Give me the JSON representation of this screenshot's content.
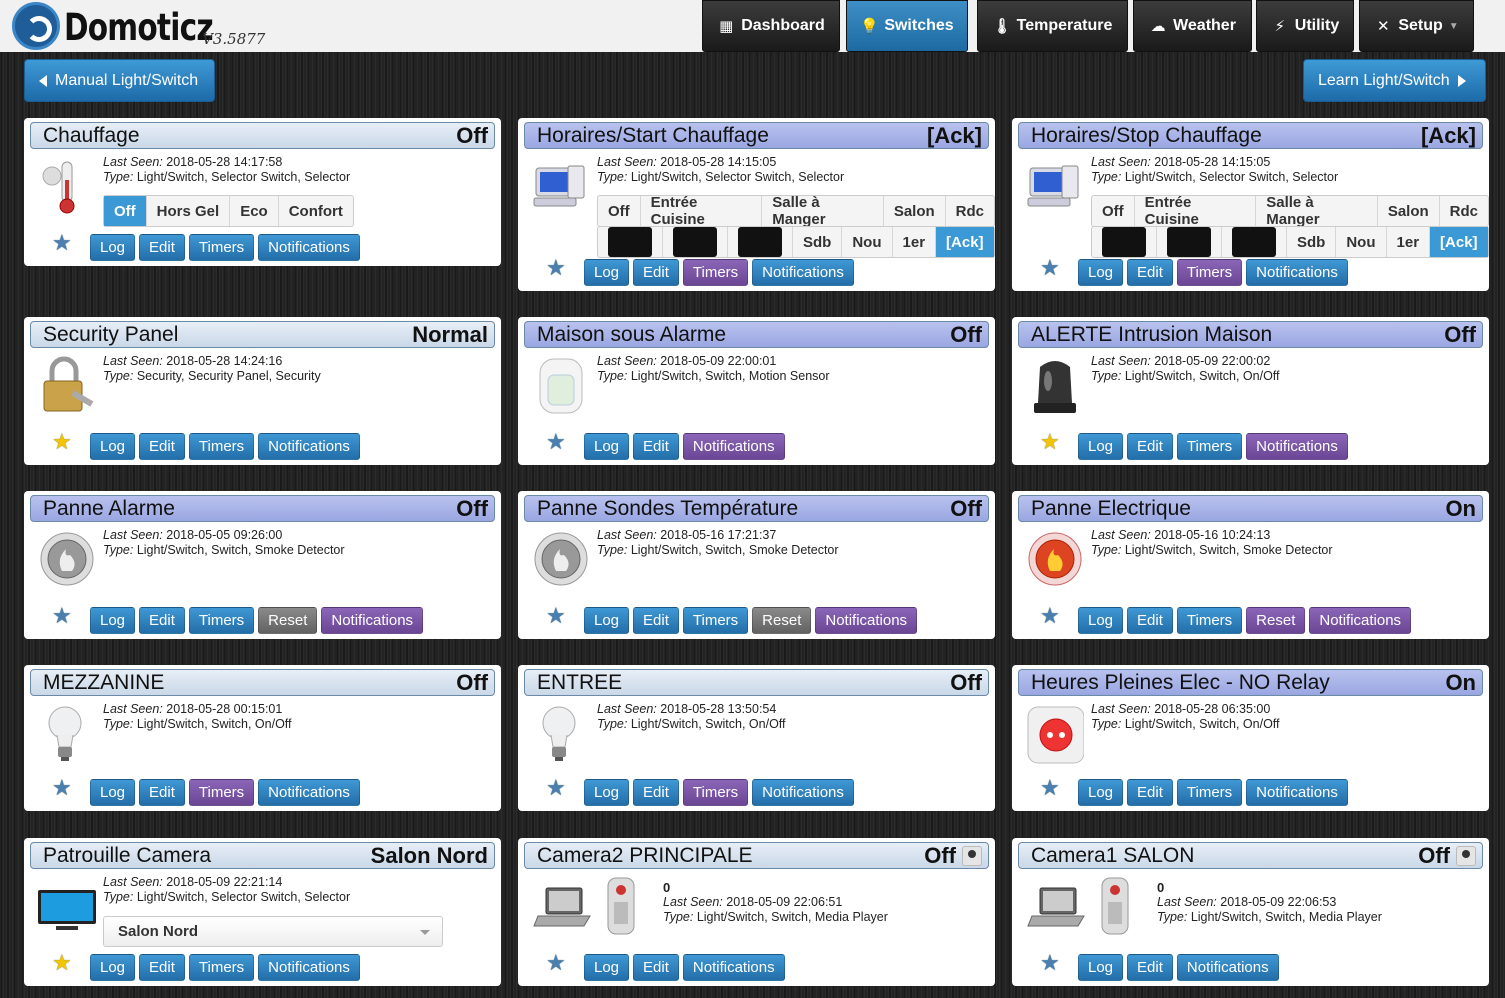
{
  "app": {
    "name": "Domoticz",
    "version": "V3.5877"
  },
  "nav": [
    {
      "label": "Dashboard",
      "icon": "dashboard-icon"
    },
    {
      "label": "Switches",
      "icon": "lightbulb-icon",
      "active": true
    },
    {
      "label": "Temperature",
      "icon": "thermometer-icon"
    },
    {
      "label": "Weather",
      "icon": "cloud-icon"
    },
    {
      "label": "Utility",
      "icon": "lightning-icon"
    },
    {
      "label": "Setup",
      "icon": "tools-icon",
      "dropdown": true
    }
  ],
  "actions": {
    "manual": "Manual Light/Switch",
    "learn": "Learn Light/Switch"
  },
  "labels": {
    "last_seen": "Last Seen:",
    "type": "Type:",
    "log": "Log",
    "edit": "Edit",
    "timers": "Timers",
    "reset": "Reset",
    "notifications": "Notifications"
  },
  "devices": [
    {
      "name": "Chauffage",
      "status": "Off",
      "last_seen": "2018-05-28 14:17:58",
      "type": "Light/Switch, Selector Switch, Selector",
      "icon": "thermometer-icon",
      "fav": false,
      "selector_options": [
        "Off",
        "Hors Gel",
        "Eco",
        "Confort"
      ],
      "selector_selected": "Off"
    },
    {
      "name": "Horaires/Start Chauffage",
      "status": "[Ack]",
      "last_seen": "2018-05-28 14:15:05",
      "type": "Light/Switch, Selector Switch, Selector",
      "icon": "computer-icon",
      "fav": false,
      "selector_row1": [
        "Off",
        "Entrée Cuisine",
        "Salle à Manger",
        "Salon",
        "Rdc"
      ],
      "selector_row2": [
        "Sdb",
        "Nou",
        "1er",
        "[Ack]"
      ],
      "selector_selected": "[Ack]"
    },
    {
      "name": "Horaires/Stop Chauffage",
      "status": "[Ack]",
      "last_seen": "2018-05-28 14:15:05",
      "type": "Light/Switch, Selector Switch, Selector",
      "icon": "computer-icon",
      "fav": false,
      "selector_row1": [
        "Off",
        "Entrée Cuisine",
        "Salle à Manger",
        "Salon",
        "Rdc"
      ],
      "selector_row2": [
        "Sdb",
        "Nou",
        "1er",
        "[Ack]"
      ],
      "selector_selected": "[Ack]"
    },
    {
      "name": "Security Panel",
      "status": "Normal",
      "last_seen": "2018-05-28 14:24:16",
      "type": "Security, Security Panel, Security",
      "icon": "padlock-icon",
      "fav": true
    },
    {
      "name": "Maison sous Alarme",
      "status": "Off",
      "last_seen": "2018-05-09 22:00:01",
      "type": "Light/Switch, Switch, Motion Sensor",
      "icon": "motion-sensor-icon",
      "fav": false
    },
    {
      "name": "ALERTE Intrusion Maison",
      "status": "Off",
      "last_seen": "2018-05-09 22:00:02",
      "type": "Light/Switch, Switch, On/Off",
      "icon": "siren-icon",
      "fav": true
    },
    {
      "name": "Panne Alarme",
      "status": "Off",
      "last_seen": "2018-05-05 09:26:00",
      "type": "Light/Switch, Switch, Smoke Detector",
      "icon": "smoke-detector-icon",
      "fav": false
    },
    {
      "name": "Panne Sondes Température",
      "status": "Off",
      "last_seen": "2018-05-16 17:21:37",
      "type": "Light/Switch, Switch, Smoke Detector",
      "icon": "smoke-detector-icon",
      "fav": false
    },
    {
      "name": "Panne Electrique",
      "status": "On",
      "last_seen": "2018-05-16 10:24:13",
      "type": "Light/Switch, Switch, Smoke Detector",
      "icon": "smoke-detector-on-icon",
      "fav": false
    },
    {
      "name": "MEZZANINE",
      "status": "Off",
      "last_seen": "2018-05-28 00:15:01",
      "type": "Light/Switch, Switch, On/Off",
      "icon": "lightbulb-icon",
      "fav": false
    },
    {
      "name": "ENTREE",
      "status": "Off",
      "last_seen": "2018-05-28 13:50:54",
      "type": "Light/Switch, Switch, On/Off",
      "icon": "lightbulb-icon",
      "fav": false
    },
    {
      "name": "Heures Pleines Elec - NO Relay",
      "status": "On",
      "last_seen": "2018-05-28 06:35:00",
      "type": "Light/Switch, Switch, On/Off",
      "icon": "power-outlet-icon",
      "fav": false
    },
    {
      "name": "Patrouille Camera",
      "status": "Salon Nord",
      "last_seen": "2018-05-09 22:21:14",
      "type": "Light/Switch, Selector Switch, Selector",
      "icon": "monitor-icon",
      "fav": true,
      "dropdown_value": "Salon Nord"
    },
    {
      "name": "Camera2 PRINCIPALE",
      "status": "Off",
      "value": "0",
      "last_seen": "2018-05-09 22:06:51",
      "type": "Light/Switch, Switch, Media Player",
      "icon": "laptop-remote-icon",
      "fav": false
    },
    {
      "name": "Camera1 SALON",
      "status": "Off",
      "value": "0",
      "last_seen": "2018-05-09 22:06:53",
      "type": "Light/Switch, Switch, Media Player",
      "icon": "laptop-remote-icon",
      "fav": false
    }
  ]
}
